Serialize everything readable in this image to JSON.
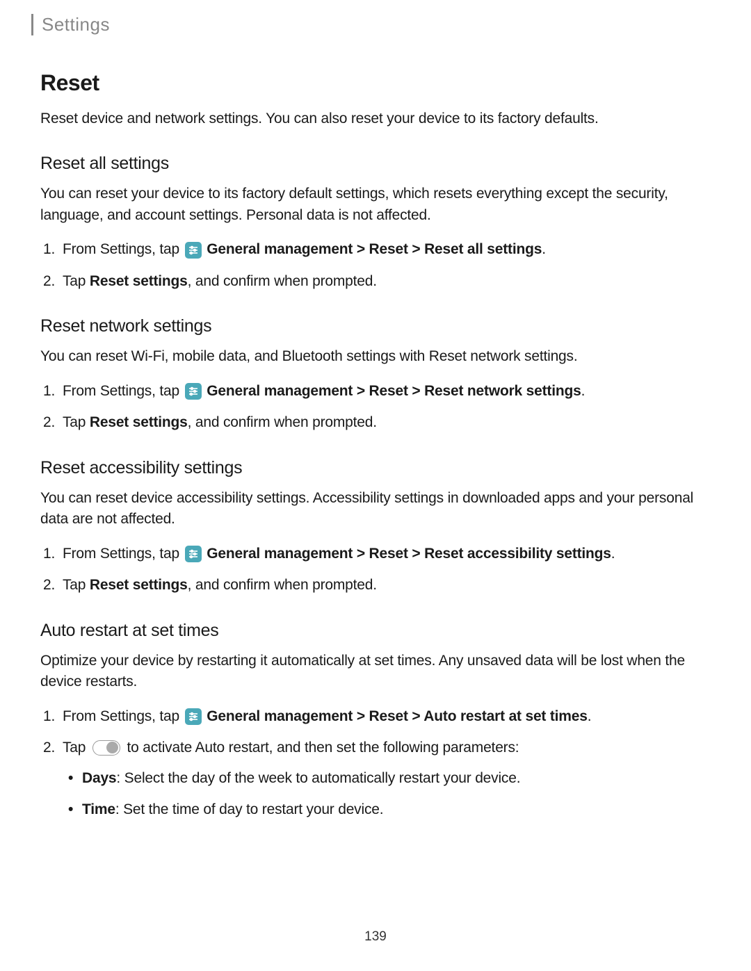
{
  "breadcrumb": "Settings",
  "page_title": "Reset",
  "intro": "Reset device and network settings. You can also reset your device to its factory defaults.",
  "sections": {
    "reset_all": {
      "title": "Reset all settings",
      "desc": "You can reset your device to its factory default settings, which resets everything except the security, language, and account settings. Personal data is not affected.",
      "step1_prefix": "From Settings, tap ",
      "step1_path": "General management > Reset > Reset all settings",
      "step1_suffix": ".",
      "step2_prefix": "Tap ",
      "step2_bold": "Reset settings",
      "step2_suffix": ", and confirm when prompted."
    },
    "reset_network": {
      "title": "Reset network settings",
      "desc": "You can reset Wi-Fi, mobile data, and Bluetooth settings with Reset network settings.",
      "step1_prefix": "From Settings, tap ",
      "step1_path": "General management > Reset > Reset network settings",
      "step1_suffix": ".",
      "step2_prefix": "Tap ",
      "step2_bold": "Reset settings",
      "step2_suffix": ", and confirm when prompted."
    },
    "reset_accessibility": {
      "title": "Reset accessibility settings",
      "desc": "You can reset device accessibility settings. Accessibility settings in downloaded apps and your personal data are not affected.",
      "step1_prefix": "From Settings, tap ",
      "step1_path": "General management > Reset > Reset accessibility settings",
      "step1_suffix": ".",
      "step2_prefix": "Tap ",
      "step2_bold": "Reset settings",
      "step2_suffix": ", and confirm when prompted."
    },
    "auto_restart": {
      "title": "Auto restart at set times",
      "desc": "Optimize your device by restarting it automatically at set times. Any unsaved data will be lost when the device restarts.",
      "step1_prefix": "From Settings, tap ",
      "step1_path": "General management > Reset > Auto restart at set times",
      "step1_suffix": ".",
      "step2_prefix": "Tap ",
      "step2_suffix": " to activate Auto restart, and then set the following parameters:",
      "bullets": {
        "days_label": "Days",
        "days_text": ": Select the day of the week to automatically restart your device.",
        "time_label": "Time",
        "time_text": ": Set the time of day to restart your device."
      }
    }
  },
  "page_number": "139"
}
